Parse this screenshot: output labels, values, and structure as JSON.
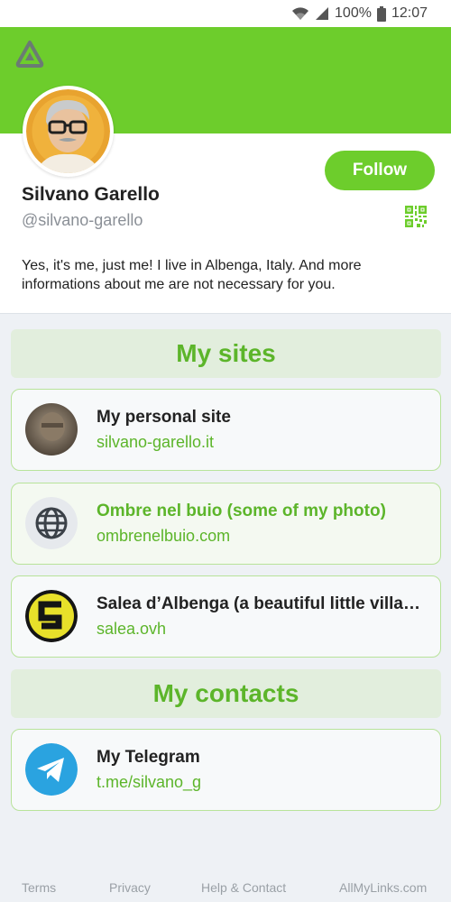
{
  "status_bar": {
    "battery": "100%",
    "time": "12:07"
  },
  "profile": {
    "name": "Silvano Garello",
    "handle": "@silvano-garello",
    "bio": "Yes, it's me, just me! I live in Albenga, Italy. And more informations about me are not necessary for you.",
    "follow_label": "Follow"
  },
  "sections": {
    "sites_title": "My sites",
    "contacts_title": "My contacts"
  },
  "sites": [
    {
      "title": "My personal site",
      "url": "silvano-garello.it",
      "icon": "personal-photo"
    },
    {
      "title": "Ombre nel buio (some of my photo)",
      "url": "ombrenelbuio.com",
      "icon": "globe-icon"
    },
    {
      "title": "Salea d’Albenga (a beautiful little villa…",
      "url": "salea.ovh",
      "icon": "salea-s-logo"
    }
  ],
  "contacts": [
    {
      "title": "My Telegram",
      "url": "t.me/silvano_g",
      "icon": "telegram-icon"
    }
  ],
  "footer": {
    "terms": "Terms",
    "privacy": "Privacy",
    "help": "Help & Contact",
    "brand": "AllMyLinks.com"
  },
  "colors": {
    "brand_green": "#6dcd2c",
    "link_green": "#5cb52a",
    "telegram_blue": "#2aa3e0"
  }
}
